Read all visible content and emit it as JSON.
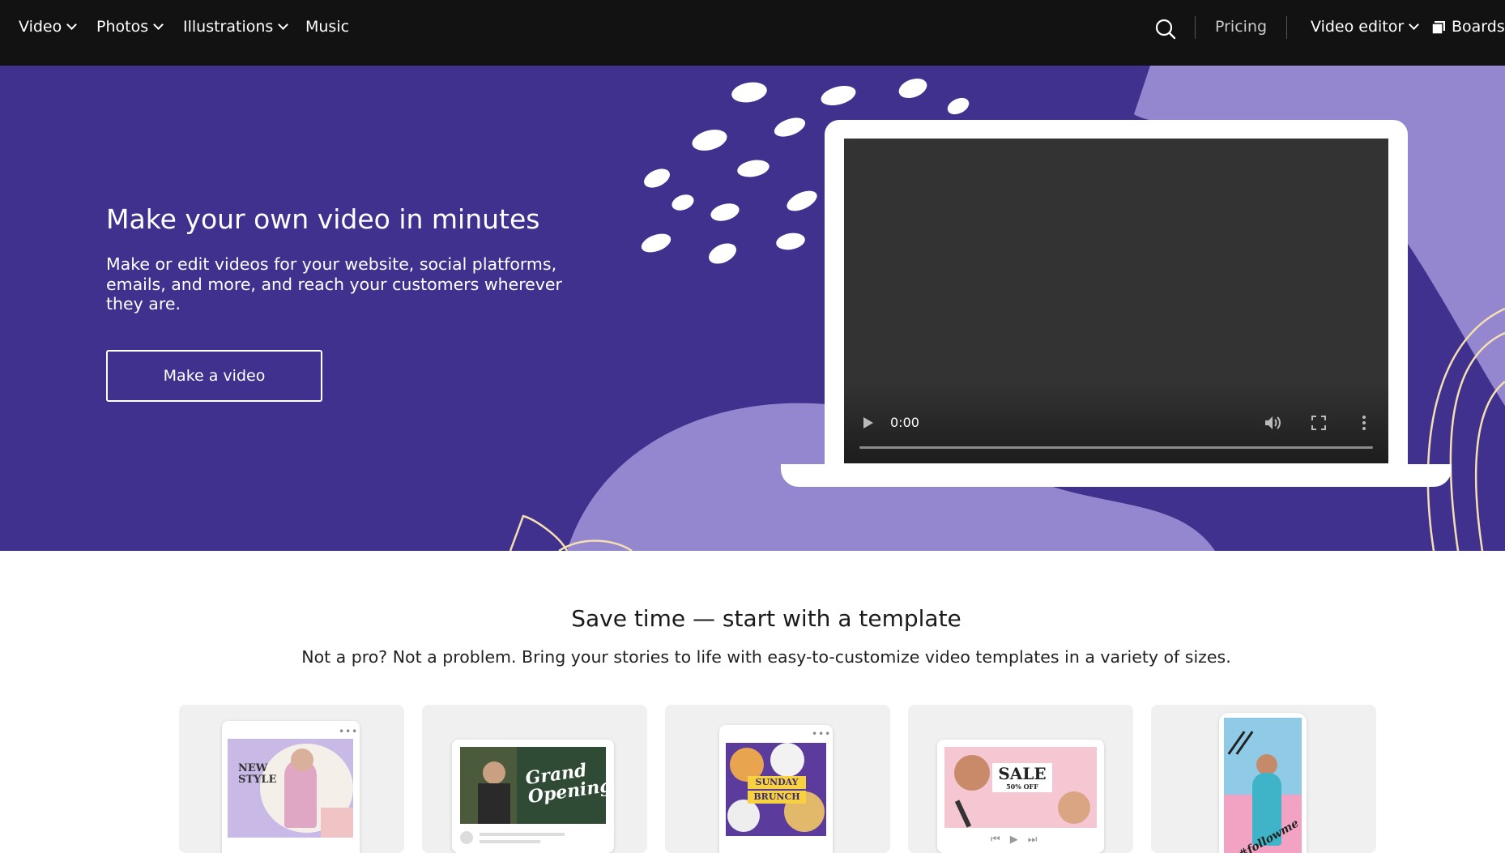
{
  "nav": {
    "left": [
      {
        "label": "Video",
        "has_menu": true
      },
      {
        "label": "Photos",
        "has_menu": true
      },
      {
        "label": "Illustrations",
        "has_menu": true
      },
      {
        "label": "Music",
        "has_menu": false
      }
    ],
    "search_icon": "search-icon",
    "pricing": "Pricing",
    "video_editor": "Video editor",
    "boards": "Boards",
    "boards_icon": "boards-icon"
  },
  "hero": {
    "title": "Make your own video in minutes",
    "description": "Make or edit videos for your website, social platforms, emails, and more, and reach your customers wherever they are.",
    "cta": "Make a video",
    "player": {
      "time": "0:00",
      "play_icon": "play-icon",
      "volume_icon": "volume-icon",
      "fullscreen_icon": "fullscreen-icon",
      "more_icon": "more-vertical-icon"
    },
    "colors": {
      "background": "#41318e",
      "accent": "#9487cf"
    }
  },
  "templates": {
    "title": "Save time — start with a template",
    "subtitle": "Not a pro? Not a problem. Bring your stories to life with easy-to-customize video templates in a variety of sizes.",
    "cards": [
      {
        "name": "new-style",
        "text_lines": [
          "NEW",
          "STYLE"
        ]
      },
      {
        "name": "grand-opening",
        "text_lines": [
          "Grand",
          "Opening"
        ]
      },
      {
        "name": "sunday-brunch",
        "text_lines": [
          "SUNDAY",
          "BRUNCH"
        ]
      },
      {
        "name": "sale",
        "text_lines": [
          "SALE",
          "50% OFF"
        ]
      },
      {
        "name": "followme",
        "text_lines": [
          "#followme"
        ]
      }
    ]
  }
}
